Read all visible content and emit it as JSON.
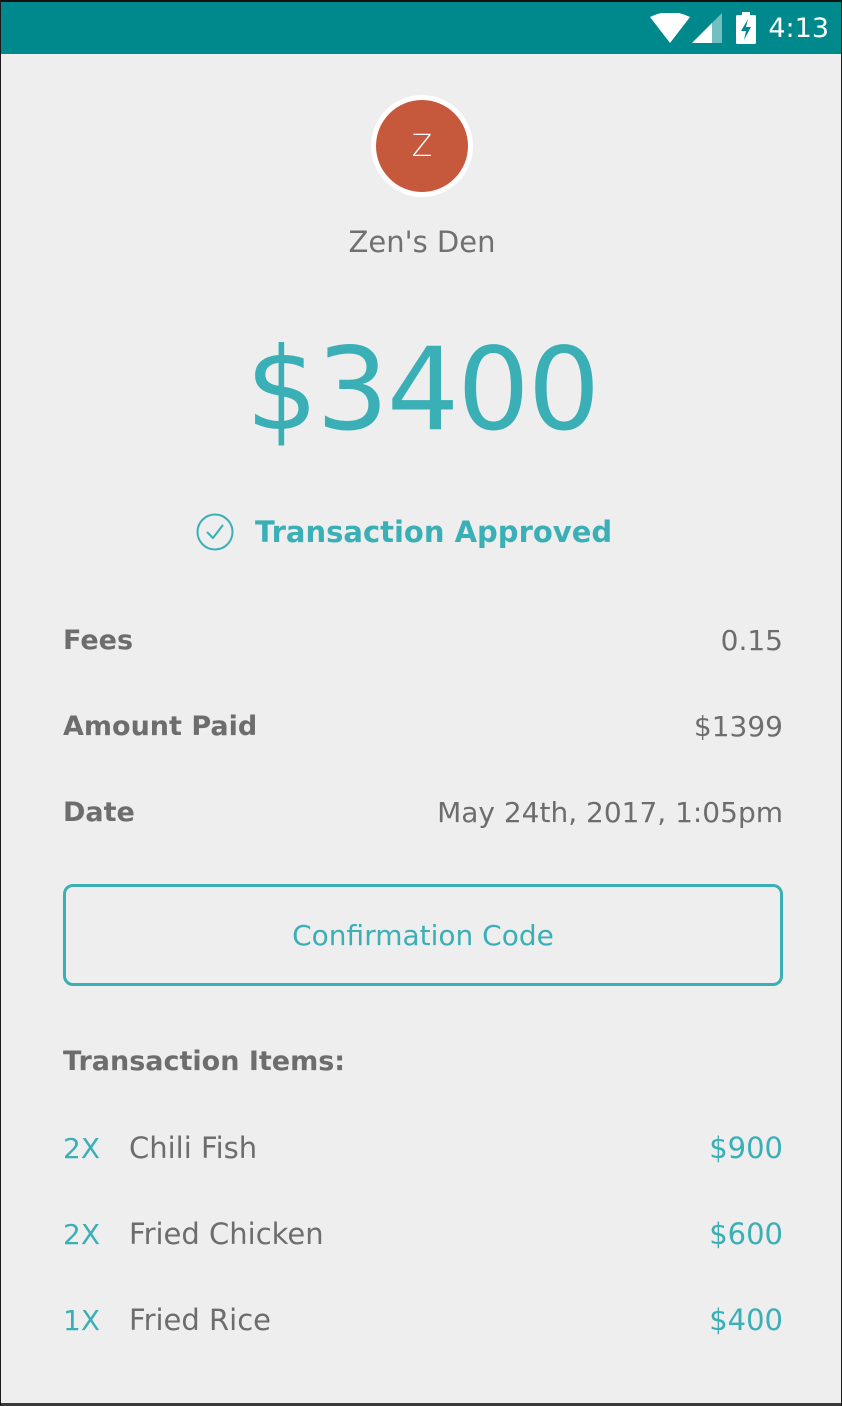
{
  "status_bar": {
    "time": "4:13",
    "icons": [
      "wifi-icon",
      "signal-icon",
      "battery-charging-icon"
    ],
    "color": "#00898c"
  },
  "merchant": {
    "initial": "Z",
    "name": "Zen's Den",
    "avatar_color": "#c6583c"
  },
  "transaction": {
    "amount": "$3400",
    "status": "Transaction Approved",
    "status_icon": "check-circle-icon",
    "accent_color": "#3aafb5"
  },
  "details": [
    {
      "label": "Fees",
      "value": "0.15"
    },
    {
      "label": "Amount Paid",
      "value": "$1399"
    },
    {
      "label": "Date",
      "value": "May 24th, 2017, 1:05pm"
    }
  ],
  "confirmation_button": {
    "label": "Confirmation Code"
  },
  "items_section": {
    "heading": "Transaction Items:",
    "items": [
      {
        "qty": "2X",
        "name": "Chili Fish",
        "price": "$900"
      },
      {
        "qty": "2X",
        "name": "Fried Chicken",
        "price": "$600"
      },
      {
        "qty": "1X",
        "name": "Fried Rice",
        "price": "$400"
      }
    ]
  }
}
